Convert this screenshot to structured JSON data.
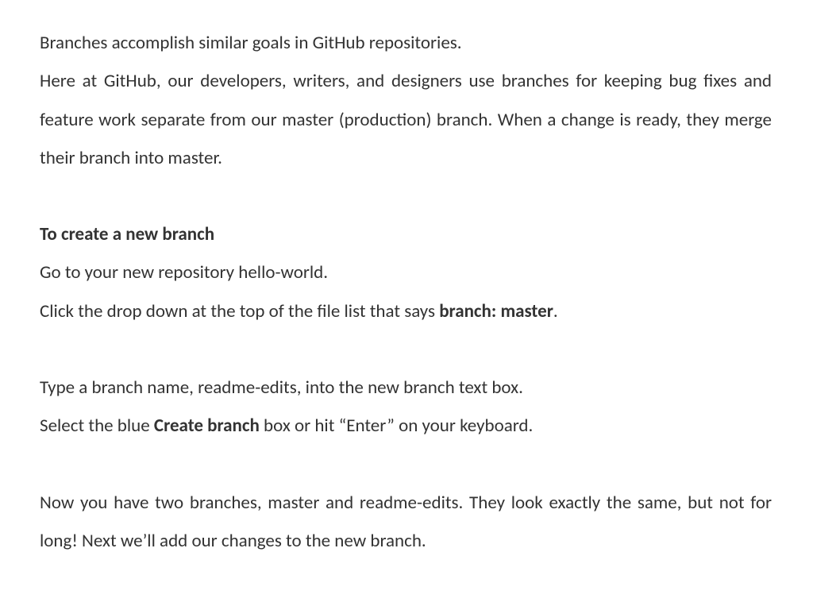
{
  "p1": "Branches accomplish similar goals in GitHub repositories.",
  "p2": "Here at GitHub, our developers, writers, and designers use branches for keeping bug fixes and feature work separate from our master (production) branch. When a change is ready, they merge their branch into master.",
  "heading1": "To create a new branch",
  "step1": "Go to your new repository hello-world.",
  "step2a": "Click the drop down at the top of the file list that says ",
  "step2b": "branch: master",
  "step2c": ".",
  "step3": "Type a branch name, readme-edits, into the new branch text box.",
  "step4a": "Select the blue ",
  "step4b": "Create branch",
  "step4c": " box or hit “Enter” on your keyboard.",
  "closing": "Now you have two branches, master and readme-edits. They look exactly the same, but not for long! Next we’ll add our changes to the new branch."
}
